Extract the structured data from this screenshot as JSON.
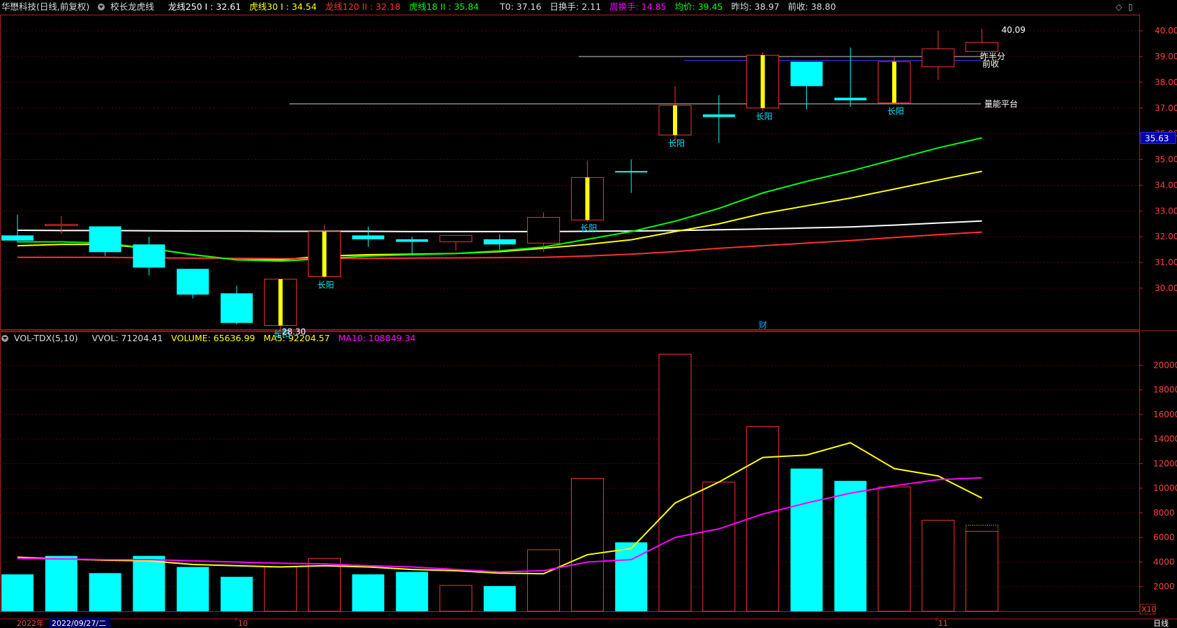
{
  "header": {
    "title": "华懋科技(日线,前复权)",
    "indicator_name": "校长龙虎线",
    "items": [
      {
        "label": "龙线250 I : 32.61",
        "color": "#ffffff"
      },
      {
        "label": "虎线30 I : 34.54",
        "color": "#ffff00"
      },
      {
        "label": "龙线120 II : 32.18",
        "color": "#ff3030"
      },
      {
        "label": "虎线18 II : 35.84",
        "color": "#00ff00"
      },
      {
        "label": "T0: 37.16",
        "color": "#dddddd"
      },
      {
        "label": "日换手: 2.11",
        "color": "#dddddd"
      },
      {
        "label": "周换手: 14.85",
        "color": "#ff00ff"
      },
      {
        "label": "均价: 39.45",
        "color": "#00ff00"
      },
      {
        "label": "昨均: 38.97",
        "color": "#dddddd"
      },
      {
        "label": "前收: 38.80",
        "color": "#dddddd"
      }
    ]
  },
  "vol_header": {
    "name": "VOL-TDX(5,10)",
    "items": [
      {
        "label": "VVOL: 71204.41",
        "color": "#dddddd"
      },
      {
        "label": "VOLUME: 65636.99",
        "color": "#ffff00"
      },
      {
        "label": "MA5: 92204.57",
        "color": "#ffff00"
      },
      {
        "label": "MA10: 108849.34",
        "color": "#ff00ff"
      }
    ]
  },
  "bottom_bar": {
    "year": "2022年",
    "date": "2022/09/27/二",
    "month_10": "10",
    "month_11": "11",
    "zoom": "X10",
    "period": "日线"
  },
  "current_price_label": "35.63",
  "colors": {
    "up": "#ff3030",
    "down": "#00ffff",
    "grid": "#5a0000",
    "axis": "#b02020"
  },
  "chart_data": [
    {
      "type": "candlestick",
      "title": "华懋科技(日线,前复权)",
      "ylim": [
        28.4,
        40.6
      ],
      "y_ticks": [
        30,
        31,
        32,
        33,
        34,
        35,
        36,
        37,
        38,
        39,
        40
      ],
      "y_tick_labels": [
        "30.00",
        "31.00",
        "32.00",
        "33.00",
        "34.00",
        "35.00",
        "36.00",
        "37.00",
        "38.00",
        "39.00",
        "40.00"
      ],
      "candles": [
        {
          "open": 32.05,
          "close": 31.85,
          "high": 32.85,
          "low": 31.8
        },
        {
          "open": 32.48,
          "close": 32.48,
          "high": 32.8,
          "low": 32.1
        },
        {
          "open": 32.4,
          "close": 31.4,
          "high": 32.4,
          "low": 31.25
        },
        {
          "open": 31.7,
          "close": 30.8,
          "high": 32.0,
          "low": 30.5
        },
        {
          "open": 30.75,
          "close": 29.75,
          "high": 30.75,
          "low": 29.6
        },
        {
          "open": 29.8,
          "close": 28.65,
          "high": 30.1,
          "low": 28.6
        },
        {
          "open": 28.55,
          "close": 30.35,
          "high": 30.35,
          "low": 28.3
        },
        {
          "open": 30.45,
          "close": 32.2,
          "high": 32.45,
          "low": 30.4
        },
        {
          "open": 32.05,
          "close": 31.9,
          "high": 32.4,
          "low": 31.6
        },
        {
          "open": 31.9,
          "close": 31.8,
          "high": 32.0,
          "low": 31.3
        },
        {
          "open": 31.8,
          "close": 32.05,
          "high": 32.05,
          "low": 31.45
        },
        {
          "open": 31.9,
          "close": 31.7,
          "high": 32.1,
          "low": 31.5
        },
        {
          "open": 31.75,
          "close": 32.75,
          "high": 32.95,
          "low": 31.4
        },
        {
          "open": 32.65,
          "close": 34.3,
          "high": 34.95,
          "low": 32.6
        },
        {
          "open": 34.55,
          "close": 34.5,
          "high": 35.0,
          "low": 33.7
        },
        {
          "open": 35.95,
          "close": 37.1,
          "high": 37.85,
          "low": 35.6
        },
        {
          "open": 36.75,
          "close": 36.65,
          "high": 37.5,
          "low": 35.65
        },
        {
          "open": 37.0,
          "close": 39.05,
          "high": 39.15,
          "low": 36.9
        },
        {
          "open": 38.8,
          "close": 37.85,
          "high": 38.8,
          "low": 36.95
        },
        {
          "open": 37.4,
          "close": 37.3,
          "high": 39.35,
          "low": 37.05
        },
        {
          "open": 37.2,
          "close": 38.8,
          "high": 39.0,
          "low": 37.2
        },
        {
          "open": 38.6,
          "close": 39.3,
          "high": 40.0,
          "low": 38.1
        },
        {
          "open": 39.2,
          "close": 39.55,
          "high": 40.09,
          "low": 39.15
        }
      ],
      "long_yang_marks": [
        6,
        7,
        13,
        15,
        17,
        20
      ],
      "long_yang_label": "长阳",
      "annotations": [
        {
          "text": "28.30",
          "candle": 6,
          "price": 28.3
        },
        {
          "text": "40.09",
          "candle": 22,
          "price": 40.09
        },
        {
          "text": "昨半分",
          "price": 39.0
        },
        {
          "text": "前收",
          "price": 38.8
        },
        {
          "text": "量能平台",
          "price": 37.16
        },
        {
          "text": "财",
          "candle": 17
        }
      ],
      "hlines": [
        {
          "price": 39.0,
          "color": "#cccccc",
          "from_candle": 12.8
        },
        {
          "price": 38.85,
          "color": "#3333ff",
          "from_candle": 15.2
        },
        {
          "price": 37.16,
          "color": "#cccccc",
          "from_candle": 6.2
        }
      ],
      "series": [
        {
          "name": "龙线250 I",
          "color": "#ffffff",
          "values": [
            32.25,
            32.24,
            32.24,
            32.23,
            32.22,
            32.22,
            32.21,
            32.21,
            32.21,
            32.2,
            32.2,
            32.2,
            32.2,
            32.21,
            32.22,
            32.24,
            32.27,
            32.3,
            32.34,
            32.38,
            32.45,
            32.53,
            32.61
          ]
        },
        {
          "name": "虎线30 I",
          "color": "#ffff00",
          "values": [
            31.65,
            31.7,
            31.7,
            31.55,
            31.3,
            31.1,
            31.1,
            31.25,
            31.3,
            31.32,
            31.35,
            31.42,
            31.55,
            31.7,
            31.88,
            32.2,
            32.5,
            32.9,
            33.2,
            33.5,
            33.85,
            34.2,
            34.54
          ]
        },
        {
          "name": "龙线120 II",
          "color": "#ff3030",
          "values": [
            31.2,
            31.2,
            31.2,
            31.18,
            31.17,
            31.16,
            31.15,
            31.15,
            31.16,
            31.17,
            31.18,
            31.19,
            31.2,
            31.25,
            31.32,
            31.42,
            31.55,
            31.65,
            31.75,
            31.85,
            31.97,
            32.08,
            32.18
          ]
        },
        {
          "name": "虎线18 II",
          "color": "#00ff00",
          "values": [
            31.8,
            31.8,
            31.75,
            31.55,
            31.3,
            31.1,
            31.05,
            31.15,
            31.25,
            31.3,
            31.35,
            31.45,
            31.6,
            31.9,
            32.2,
            32.6,
            33.1,
            33.7,
            34.15,
            34.55,
            35.0,
            35.45,
            35.84
          ]
        }
      ]
    },
    {
      "type": "bar",
      "title": "VOL-TDX(5,10)",
      "ylim": [
        0,
        21500
      ],
      "y_ticks": [
        2000,
        4000,
        6000,
        8000,
        10000,
        12000,
        14000,
        16000,
        18000,
        20000
      ],
      "values": [
        3000,
        4500,
        3100,
        4500,
        3600,
        2800,
        3600,
        4300,
        3000,
        3200,
        2100,
        2050,
        5000,
        10800,
        5600,
        20900,
        10500,
        15000,
        11600,
        10600,
        10100,
        7400,
        6500
      ],
      "up": [
        false,
        false,
        false,
        false,
        false,
        false,
        true,
        true,
        false,
        false,
        true,
        false,
        true,
        true,
        false,
        true,
        true,
        true,
        false,
        false,
        true,
        true,
        true
      ],
      "last_estimate": 7000,
      "series": [
        {
          "name": "MA5",
          "color": "#ffff00",
          "values": [
            4400,
            4250,
            4150,
            4100,
            3800,
            3700,
            3600,
            3700,
            3600,
            3400,
            3300,
            3100,
            3050,
            4600,
            5100,
            8800,
            10500,
            12500,
            12700,
            13700,
            11600,
            11000,
            9200
          ]
        },
        {
          "name": "MA10",
          "color": "#ff00ff",
          "values": [
            4300,
            4250,
            4200,
            4200,
            4100,
            4000,
            3900,
            3850,
            3700,
            3600,
            3400,
            3200,
            3300,
            4000,
            4200,
            6000,
            6700,
            7900,
            8800,
            9600,
            10200,
            10700,
            10850
          ]
        }
      ]
    }
  ]
}
